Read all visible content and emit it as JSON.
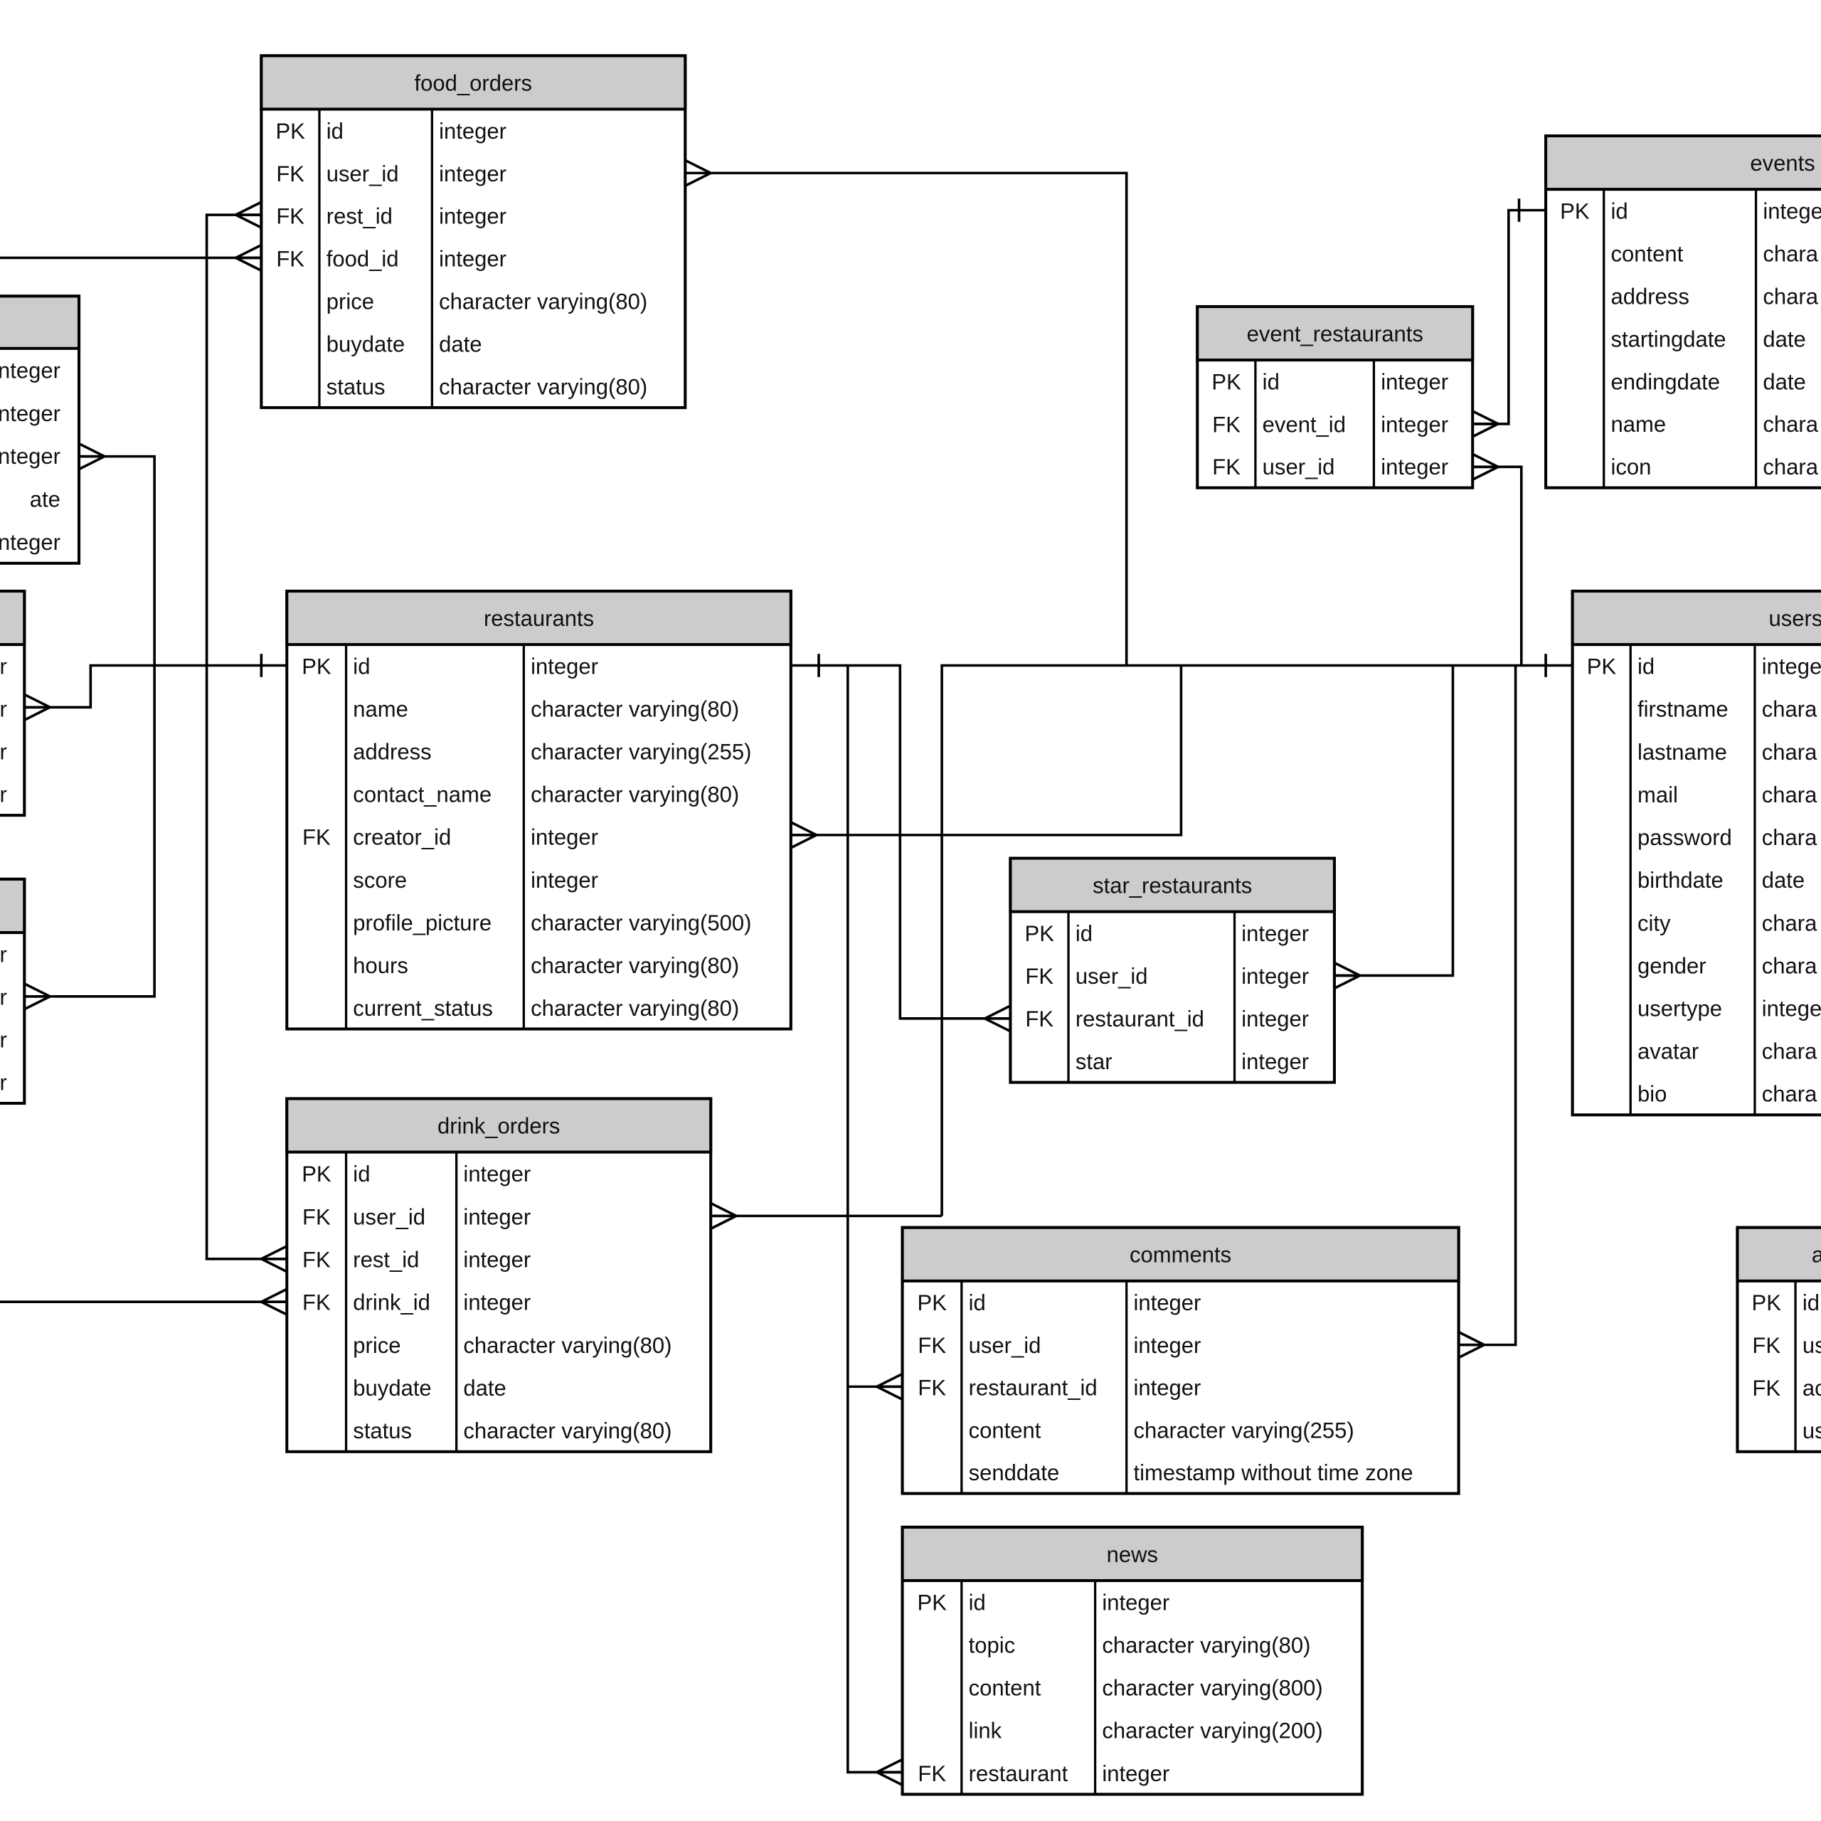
{
  "colors": {
    "header_fill": "#cccccc",
    "line": "#000000",
    "background": "#ffffff"
  },
  "tables": [
    {
      "id": "food_orders",
      "name": "food_orders",
      "rows": [
        [
          "PK",
          "id",
          "integer"
        ],
        [
          "FK",
          "user_id",
          "integer"
        ],
        [
          "FK",
          "rest_id",
          "integer"
        ],
        [
          "FK",
          "food_id",
          "integer"
        ],
        [
          "",
          "price",
          "character varying(80)"
        ],
        [
          "",
          "buydate",
          "date"
        ],
        [
          "",
          "status",
          "character varying(80)"
        ]
      ]
    },
    {
      "id": "events",
      "name": "events",
      "rows": [
        [
          "PK",
          "id",
          "intege"
        ],
        [
          "",
          "content",
          "chara"
        ],
        [
          "",
          "address",
          "chara"
        ],
        [
          "",
          "startingdate",
          "date"
        ],
        [
          "",
          "endingdate",
          "date"
        ],
        [
          "",
          "name",
          "chara"
        ],
        [
          "",
          "icon",
          "chara"
        ]
      ]
    },
    {
      "id": "event_restaurants",
      "name": "event_restaurants",
      "rows": [
        [
          "PK",
          "id",
          "integer"
        ],
        [
          "FK",
          "event_id",
          "integer"
        ],
        [
          "FK",
          "user_id",
          "integer"
        ]
      ]
    },
    {
      "id": "left1",
      "name": "",
      "rows": [
        [
          "",
          "",
          "nteger"
        ],
        [
          "",
          "",
          "nteger"
        ],
        [
          "",
          "",
          "nteger"
        ],
        [
          "",
          "",
          "ate"
        ],
        [
          "",
          "",
          "nteger"
        ]
      ]
    },
    {
      "id": "left2",
      "name": "",
      "rows": [
        [
          "",
          "",
          "r"
        ],
        [
          "",
          "",
          "r"
        ],
        [
          "",
          "",
          "r"
        ],
        [
          "",
          "",
          "r"
        ]
      ]
    },
    {
      "id": "left3",
      "name": "",
      "rows": [
        [
          "",
          "",
          "r"
        ],
        [
          "",
          "",
          "r"
        ],
        [
          "",
          "",
          "r"
        ],
        [
          "",
          "",
          "r"
        ]
      ]
    },
    {
      "id": "restaurants",
      "name": "restaurants",
      "rows": [
        [
          "PK",
          "id",
          "integer"
        ],
        [
          "",
          "name",
          "character varying(80)"
        ],
        [
          "",
          "address",
          "character varying(255)"
        ],
        [
          "",
          "contact_name",
          "character varying(80)"
        ],
        [
          "FK",
          "creator_id",
          "integer"
        ],
        [
          "",
          "score",
          "integer"
        ],
        [
          "",
          "profile_picture",
          "character varying(500)"
        ],
        [
          "",
          "hours",
          "character varying(80)"
        ],
        [
          "",
          "current_status",
          "character varying(80)"
        ]
      ]
    },
    {
      "id": "star_restaurants",
      "name": "star_restaurants",
      "rows": [
        [
          "PK",
          "id",
          "integer"
        ],
        [
          "FK",
          "user_id",
          "integer"
        ],
        [
          "FK",
          "restaurant_id",
          "integer"
        ],
        [
          "",
          "star",
          "integer"
        ]
      ]
    },
    {
      "id": "users",
      "name": "users",
      "rows": [
        [
          "PK",
          "id",
          "intege"
        ],
        [
          "",
          "firstname",
          "chara"
        ],
        [
          "",
          "lastname",
          "chara"
        ],
        [
          "",
          "mail",
          "chara"
        ],
        [
          "",
          "password",
          "chara"
        ],
        [
          "",
          "birthdate",
          "date"
        ],
        [
          "",
          "city",
          "chara"
        ],
        [
          "",
          "gender",
          "chara"
        ],
        [
          "",
          "usertype",
          "intege"
        ],
        [
          "",
          "avatar",
          "chara"
        ],
        [
          "",
          "bio",
          "chara"
        ]
      ]
    },
    {
      "id": "drink_orders",
      "name": "drink_orders",
      "rows": [
        [
          "PK",
          "id",
          "integer"
        ],
        [
          "FK",
          "user_id",
          "integer"
        ],
        [
          "FK",
          "rest_id",
          "integer"
        ],
        [
          "FK",
          "drink_id",
          "integer"
        ],
        [
          "",
          "price",
          "character varying(80)"
        ],
        [
          "",
          "buydate",
          "date"
        ],
        [
          "",
          "status",
          "character varying(80)"
        ]
      ]
    },
    {
      "id": "comments",
      "name": "comments",
      "rows": [
        [
          "PK",
          "id",
          "integer"
        ],
        [
          "FK",
          "user_id",
          "integer"
        ],
        [
          "FK",
          "restaurant_id",
          "integer"
        ],
        [
          "",
          "content",
          "character varying(255)"
        ],
        [
          "",
          "senddate",
          "timestamp without time zone"
        ]
      ]
    },
    {
      "id": "news",
      "name": "news",
      "rows": [
        [
          "PK",
          "id",
          "integer"
        ],
        [
          "",
          "topic",
          "character varying(80)"
        ],
        [
          "",
          "content",
          "character varying(800)"
        ],
        [
          "",
          "link",
          "character varying(200)"
        ],
        [
          "FK",
          "restaurant",
          "integer"
        ]
      ]
    },
    {
      "id": "a_partial",
      "name": "a",
      "rows": [
        [
          "PK",
          "id",
          ""
        ],
        [
          "FK",
          "us",
          ""
        ],
        [
          "FK",
          "ac",
          ""
        ],
        [
          "",
          "us",
          ""
        ]
      ]
    }
  ]
}
